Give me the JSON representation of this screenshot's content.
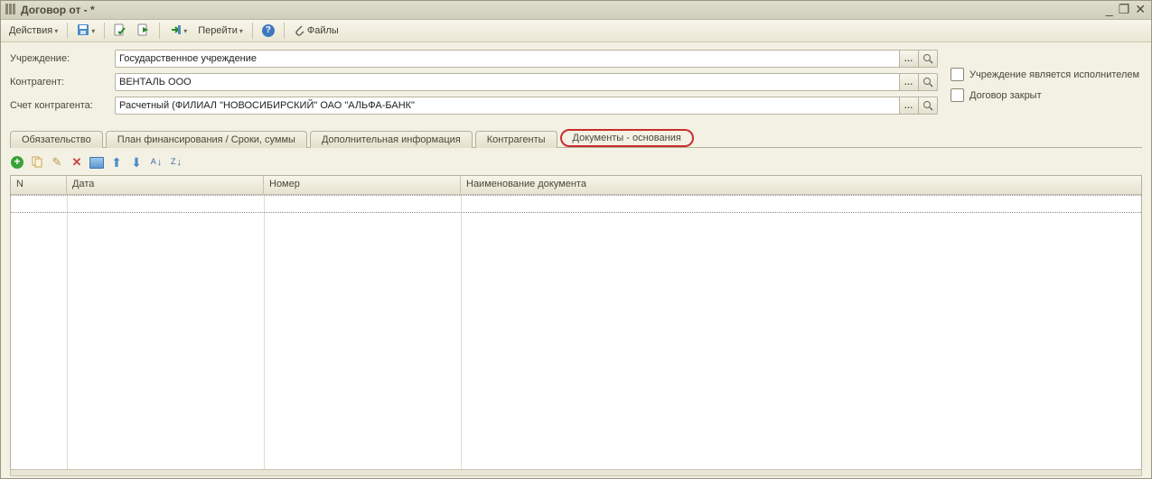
{
  "window": {
    "title": "Договор  от - *"
  },
  "toolbar": {
    "actions_label": "Действия",
    "go_label": "Перейти",
    "files_label": "Файлы"
  },
  "form": {
    "institution_label": "Учреждение:",
    "institution_value": "Государственное учреждение",
    "counterparty_label": "Контрагент:",
    "counterparty_value": "ВЕНТАЛЬ ООО",
    "account_label": "Счет контрагента:",
    "account_value": "Расчетный (ФИЛИАЛ \"НОВОСИБИРСКИЙ\" ОАО \"АЛЬФА-БАНК\""
  },
  "checkboxes": {
    "is_executor_label": "Учреждение является исполнителем",
    "closed_label": "Договор закрыт"
  },
  "tabs": [
    {
      "label": "Обязательство"
    },
    {
      "label": "План финансирования / Сроки, суммы"
    },
    {
      "label": "Дополнительная информация"
    },
    {
      "label": "Контрагенты"
    },
    {
      "label": "Документы - основания"
    }
  ],
  "grid": {
    "columns": {
      "n": "N",
      "date": "Дата",
      "number": "Номер",
      "doc_name": "Наименование документа"
    },
    "rows": []
  }
}
